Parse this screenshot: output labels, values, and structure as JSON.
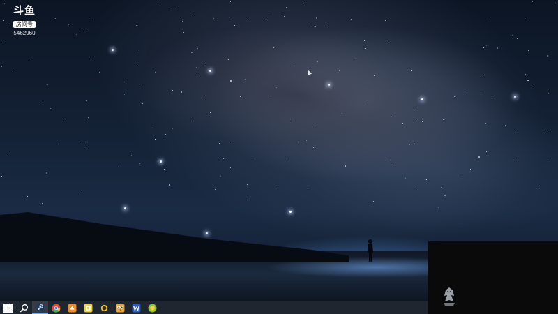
{
  "logo": {
    "main_text": "斗鱼",
    "sub_text": "房间号",
    "room_number": "5462960"
  },
  "taskbar": {
    "items": [
      {
        "name": "start-icon"
      },
      {
        "name": "search-icon"
      },
      {
        "name": "steam-icon"
      },
      {
        "name": "chrome-icon"
      },
      {
        "name": "orange-app-icon"
      },
      {
        "name": "yellow-app-icon"
      },
      {
        "name": "ring-app-icon"
      },
      {
        "name": "owl-app-icon"
      },
      {
        "name": "blue-app-icon"
      },
      {
        "name": "green-app-icon"
      }
    ]
  },
  "colors": {
    "taskbar_bg": "#1f2630",
    "accent": "#79a9e8"
  }
}
